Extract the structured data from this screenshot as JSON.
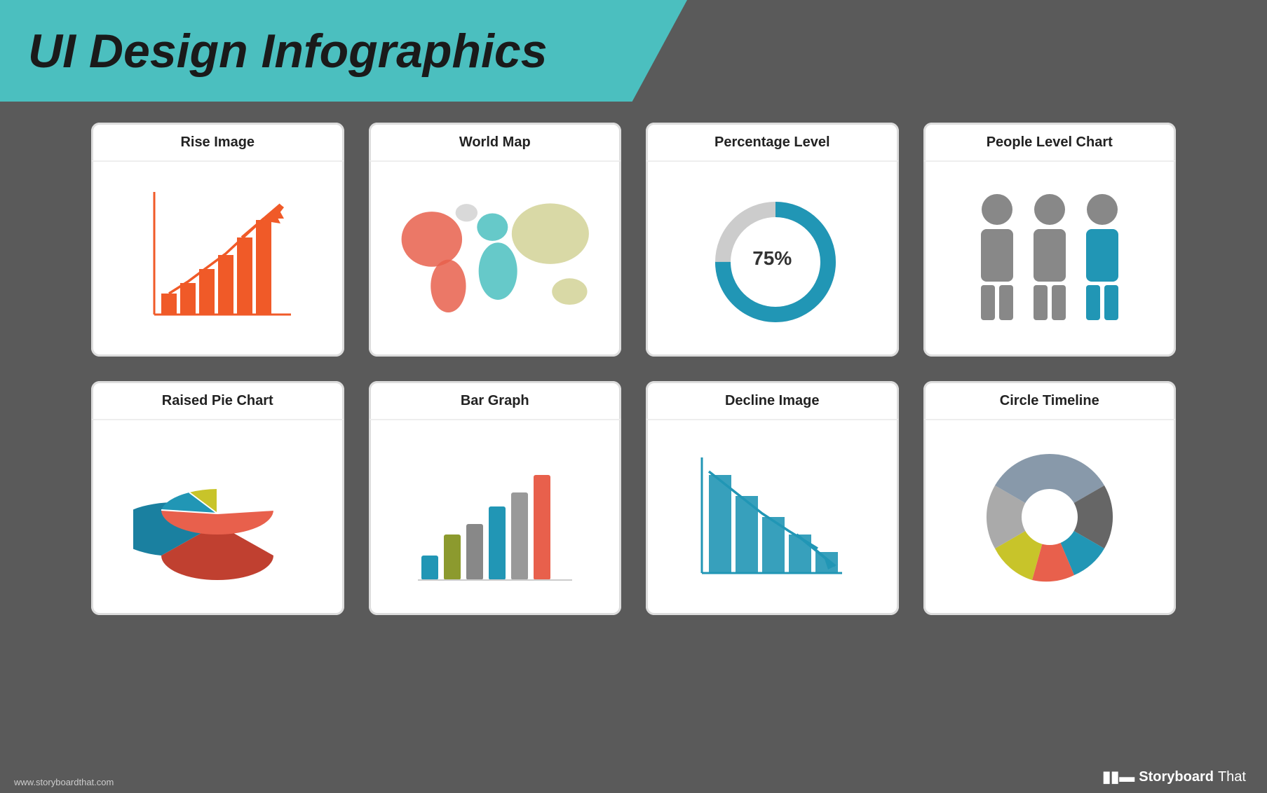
{
  "header": {
    "title": "UI Design Infographics"
  },
  "cards": [
    {
      "id": "rise-image",
      "label": "Rise Image",
      "type": "rise-chart"
    },
    {
      "id": "world-map",
      "label": "World Map",
      "type": "world-map"
    },
    {
      "id": "percentage-level",
      "label": "Percentage Level",
      "type": "donut",
      "value": "75%",
      "percentage": 75
    },
    {
      "id": "people-level-chart",
      "label": "People Level Chart",
      "type": "people"
    },
    {
      "id": "raised-pie-chart",
      "label": "Raised Pie Chart",
      "type": "pie"
    },
    {
      "id": "bar-graph",
      "label": "Bar Graph",
      "type": "bar"
    },
    {
      "id": "decline-image",
      "label": "Decline Image",
      "type": "decline"
    },
    {
      "id": "circle-timeline",
      "label": "Circle Timeline",
      "type": "circle-timeline"
    }
  ],
  "footer": {
    "website": "www.storyboardthat.com",
    "logo_bold": "Storyboard",
    "logo_normal": "That"
  },
  "colors": {
    "teal": "#4bbfbf",
    "orange": "#f05a28",
    "blue": "#2196b5",
    "gray": "#888888",
    "lightgray": "#aaaaaa",
    "olive": "#8c9a2e",
    "coral": "#e8604c",
    "yellow": "#c8c42a",
    "darkgray": "#5a5a5a"
  }
}
